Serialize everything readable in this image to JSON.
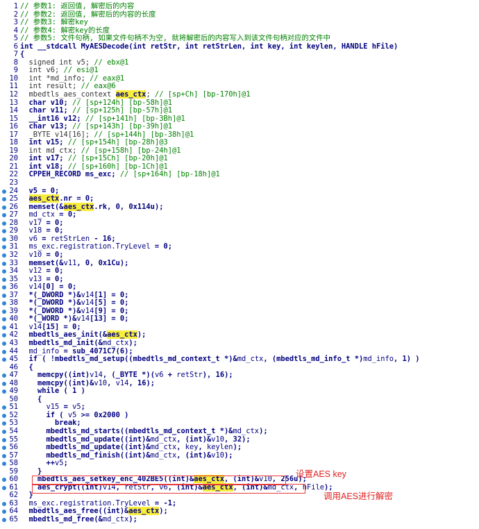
{
  "colors": {
    "background": "#ffffff",
    "code": "#000080",
    "comment": "#008000",
    "highlight": "#f8ed3a",
    "breakpoint_dot": "#2f86d6",
    "annotation": "#e02020"
  },
  "lines": [
    {
      "n": "1",
      "dot": false,
      "t": [
        {
          "c": "cm",
          "v": "// 参数1: 返回值, 解密后的内容"
        }
      ]
    },
    {
      "n": "2",
      "dot": false,
      "t": [
        {
          "c": "cm",
          "v": "// 参数2: 返回值, 解密后的内容的长度"
        }
      ]
    },
    {
      "n": "3",
      "dot": false,
      "t": [
        {
          "c": "cm",
          "v": "// 参数3: 解密key"
        }
      ]
    },
    {
      "n": "4",
      "dot": false,
      "t": [
        {
          "c": "cm",
          "v": "// 参数4: 解密key的长度"
        }
      ]
    },
    {
      "n": "5",
      "dot": false,
      "t": [
        {
          "c": "cm",
          "v": "// 参数5: 文件句柄, 如果文件句柄不为空, 就将解密后的内容写入到该文件句柄对应的文件中"
        }
      ]
    },
    {
      "n": "6",
      "dot": false,
      "t": [
        {
          "c": "",
          "v": "int __stdcall MyAESDecode(int retStr, int retStrLen, int key, int keylen, HANDLE hFile)"
        }
      ]
    },
    {
      "n": "7",
      "dot": false,
      "t": [
        {
          "c": "",
          "v": "{"
        }
      ]
    },
    {
      "n": "8",
      "dot": false,
      "t": [
        {
          "c": "dim",
          "v": "  signed int v5; "
        },
        {
          "c": "cm",
          "v": "// ebx@1"
        }
      ]
    },
    {
      "n": "9",
      "dot": false,
      "t": [
        {
          "c": "dim",
          "v": "  int v6; "
        },
        {
          "c": "cm",
          "v": "// esi@1"
        }
      ]
    },
    {
      "n": "10",
      "dot": false,
      "t": [
        {
          "c": "dim",
          "v": "  int *md_info; "
        },
        {
          "c": "cm",
          "v": "// eax@1"
        }
      ]
    },
    {
      "n": "11",
      "dot": false,
      "t": [
        {
          "c": "dim",
          "v": "  int result; "
        },
        {
          "c": "cm",
          "v": "// eax@6"
        }
      ]
    },
    {
      "n": "12",
      "dot": false,
      "t": [
        {
          "c": "dim",
          "v": "  mbedtls_aes_context "
        },
        {
          "c": "hl",
          "v": "aes_ctx"
        },
        {
          "c": "dim",
          "v": "; "
        },
        {
          "c": "cm",
          "v": "// [sp+Ch] [bp-170h]@1"
        }
      ]
    },
    {
      "n": "13",
      "dot": false,
      "t": [
        {
          "c": "",
          "v": "  char v10; "
        },
        {
          "c": "cm",
          "v": "// [sp+124h] [bp-58h]@1"
        }
      ]
    },
    {
      "n": "14",
      "dot": false,
      "t": [
        {
          "c": "",
          "v": "  char v11; "
        },
        {
          "c": "cm",
          "v": "// [sp+125h] [bp-57h]@1"
        }
      ]
    },
    {
      "n": "15",
      "dot": false,
      "t": [
        {
          "c": "",
          "v": "  __int16 v12; "
        },
        {
          "c": "cm",
          "v": "// [sp+141h] [bp-3Bh]@1"
        }
      ]
    },
    {
      "n": "16",
      "dot": false,
      "t": [
        {
          "c": "",
          "v": "  char v13; "
        },
        {
          "c": "cm",
          "v": "// [sp+143h] [bp-39h]@1"
        }
      ]
    },
    {
      "n": "17",
      "dot": false,
      "t": [
        {
          "c": "dim",
          "v": "  _BYTE v14[16]; "
        },
        {
          "c": "cm",
          "v": "// [sp+144h] [bp-38h]@1"
        }
      ]
    },
    {
      "n": "18",
      "dot": false,
      "t": [
        {
          "c": "",
          "v": "  int v15; "
        },
        {
          "c": "cm",
          "v": "// [sp+154h] [bp-28h]@3"
        }
      ]
    },
    {
      "n": "19",
      "dot": false,
      "t": [
        {
          "c": "dim",
          "v": "  int md_ctx; "
        },
        {
          "c": "cm",
          "v": "// [sp+158h] [bp-24h]@1"
        }
      ]
    },
    {
      "n": "20",
      "dot": false,
      "t": [
        {
          "c": "",
          "v": "  int v17; "
        },
        {
          "c": "cm",
          "v": "// [sp+15Ch] [bp-20h]@1"
        }
      ]
    },
    {
      "n": "21",
      "dot": false,
      "t": [
        {
          "c": "",
          "v": "  int v18; "
        },
        {
          "c": "cm",
          "v": "// [sp+160h] [bp-1Ch]@1"
        }
      ]
    },
    {
      "n": "22",
      "dot": false,
      "t": [
        {
          "c": "",
          "v": "  CPPEH_RECORD ms_exc; "
        },
        {
          "c": "cm",
          "v": "// [sp+164h] [bp-18h]@1"
        }
      ]
    },
    {
      "n": "23",
      "dot": false,
      "t": [
        {
          "c": "",
          "v": ""
        }
      ]
    },
    {
      "n": "24",
      "dot": true,
      "t": [
        {
          "c": "",
          "v": "  v5 = 0;"
        }
      ]
    },
    {
      "n": "25",
      "dot": true,
      "t": [
        {
          "c": "",
          "v": "  "
        },
        {
          "c": "hl",
          "v": "aes_ctx"
        },
        {
          "c": "",
          "v": ".nr = 0;"
        }
      ]
    },
    {
      "n": "26",
      "dot": true,
      "t": [
        {
          "c": "",
          "v": "  memset(&"
        },
        {
          "c": "hl",
          "v": "aes_ctx"
        },
        {
          "c": "",
          "v": ".rk, 0, 0x114u);"
        }
      ]
    },
    {
      "n": "27",
      "dot": true,
      "t": [
        {
          "c": "var",
          "v": "  md_ctx"
        },
        {
          "c": "",
          "v": " = 0;"
        }
      ]
    },
    {
      "n": "28",
      "dot": true,
      "t": [
        {
          "c": "var",
          "v": "  v17"
        },
        {
          "c": "",
          "v": " = 0;"
        }
      ]
    },
    {
      "n": "29",
      "dot": true,
      "t": [
        {
          "c": "var",
          "v": "  v18"
        },
        {
          "c": "",
          "v": " = 0;"
        }
      ]
    },
    {
      "n": "30",
      "dot": true,
      "t": [
        {
          "c": "var",
          "v": "  v6"
        },
        {
          "c": "",
          "v": " = "
        },
        {
          "c": "var",
          "v": "retStrLen"
        },
        {
          "c": "",
          "v": " - 16;"
        }
      ]
    },
    {
      "n": "31",
      "dot": true,
      "t": [
        {
          "c": "var",
          "v": "  ms_exc.registration.TryLevel"
        },
        {
          "c": "",
          "v": " = 0;"
        }
      ]
    },
    {
      "n": "32",
      "dot": true,
      "t": [
        {
          "c": "var",
          "v": "  v10"
        },
        {
          "c": "",
          "v": " = 0;"
        }
      ]
    },
    {
      "n": "33",
      "dot": true,
      "t": [
        {
          "c": "",
          "v": "  memset(&"
        },
        {
          "c": "var",
          "v": "v11"
        },
        {
          "c": "",
          "v": ", 0, 0x1Cu);"
        }
      ]
    },
    {
      "n": "34",
      "dot": true,
      "t": [
        {
          "c": "var",
          "v": "  v12"
        },
        {
          "c": "",
          "v": " = 0;"
        }
      ]
    },
    {
      "n": "35",
      "dot": true,
      "t": [
        {
          "c": "var",
          "v": "  v13"
        },
        {
          "c": "",
          "v": " = 0;"
        }
      ]
    },
    {
      "n": "36",
      "dot": true,
      "t": [
        {
          "c": "var",
          "v": "  v14"
        },
        {
          "c": "",
          "v": "[0] = 0;"
        }
      ]
    },
    {
      "n": "37",
      "dot": true,
      "t": [
        {
          "c": "",
          "v": "  *(_DWORD *)&"
        },
        {
          "c": "var",
          "v": "v14"
        },
        {
          "c": "",
          "v": "[1] = 0;"
        }
      ]
    },
    {
      "n": "38",
      "dot": true,
      "t": [
        {
          "c": "",
          "v": "  *(_DWORD *)&"
        },
        {
          "c": "var",
          "v": "v14"
        },
        {
          "c": "",
          "v": "[5] = 0;"
        }
      ]
    },
    {
      "n": "39",
      "dot": true,
      "t": [
        {
          "c": "",
          "v": "  *(_DWORD *)&"
        },
        {
          "c": "var",
          "v": "v14"
        },
        {
          "c": "",
          "v": "[9] = 0;"
        }
      ]
    },
    {
      "n": "40",
      "dot": true,
      "t": [
        {
          "c": "",
          "v": "  *(_WORD *)&"
        },
        {
          "c": "var",
          "v": "v14"
        },
        {
          "c": "",
          "v": "[13] = 0;"
        }
      ]
    },
    {
      "n": "41",
      "dot": true,
      "t": [
        {
          "c": "var",
          "v": "  v14"
        },
        {
          "c": "",
          "v": "[15] = 0;"
        }
      ]
    },
    {
      "n": "42",
      "dot": true,
      "t": [
        {
          "c": "",
          "v": "  mbedtls_aes_init(&"
        },
        {
          "c": "hl",
          "v": "aes_ctx"
        },
        {
          "c": "",
          "v": ");"
        }
      ]
    },
    {
      "n": "43",
      "dot": true,
      "t": [
        {
          "c": "",
          "v": "  mbedtls_md_init(&"
        },
        {
          "c": "var",
          "v": "md_ctx"
        },
        {
          "c": "",
          "v": ");"
        }
      ]
    },
    {
      "n": "44",
      "dot": true,
      "t": [
        {
          "c": "var",
          "v": "  md_info"
        },
        {
          "c": "",
          "v": " = sub_4071C7(6);"
        }
      ]
    },
    {
      "n": "45",
      "dot": true,
      "t": [
        {
          "c": "",
          "v": "  if ( !mbedtls_md_setup((mbedtls_md_context_t *)&"
        },
        {
          "c": "var",
          "v": "md_ctx"
        },
        {
          "c": "",
          "v": ", (mbedtls_md_info_t *)"
        },
        {
          "c": "var",
          "v": "md_info"
        },
        {
          "c": "",
          "v": ", 1) )"
        }
      ]
    },
    {
      "n": "46",
      "dot": false,
      "t": [
        {
          "c": "",
          "v": "  {"
        }
      ]
    },
    {
      "n": "47",
      "dot": true,
      "t": [
        {
          "c": "",
          "v": "    memcpy((int)"
        },
        {
          "c": "var",
          "v": "v14"
        },
        {
          "c": "",
          "v": ", (_BYTE *)("
        },
        {
          "c": "var",
          "v": "v6"
        },
        {
          "c": "",
          "v": " + "
        },
        {
          "c": "var",
          "v": "retStr"
        },
        {
          "c": "",
          "v": "), 16);"
        }
      ]
    },
    {
      "n": "48",
      "dot": true,
      "t": [
        {
          "c": "",
          "v": "    memcpy((int)&"
        },
        {
          "c": "var",
          "v": "v10"
        },
        {
          "c": "",
          "v": ", "
        },
        {
          "c": "var",
          "v": "v14"
        },
        {
          "c": "",
          "v": ", 16);"
        }
      ]
    },
    {
      "n": "49",
      "dot": true,
      "t": [
        {
          "c": "",
          "v": "    while ( 1 )"
        }
      ]
    },
    {
      "n": "50",
      "dot": false,
      "t": [
        {
          "c": "",
          "v": "    {"
        }
      ]
    },
    {
      "n": "51",
      "dot": true,
      "t": [
        {
          "c": "var",
          "v": "      v15"
        },
        {
          "c": "",
          "v": " = "
        },
        {
          "c": "var",
          "v": "v5"
        },
        {
          "c": "",
          "v": ";"
        }
      ]
    },
    {
      "n": "52",
      "dot": true,
      "t": [
        {
          "c": "",
          "v": "      if ( "
        },
        {
          "c": "var",
          "v": "v5"
        },
        {
          "c": "",
          "v": " >= 0x2000 )"
        }
      ]
    },
    {
      "n": "53",
      "dot": true,
      "t": [
        {
          "c": "",
          "v": "        break;"
        }
      ]
    },
    {
      "n": "54",
      "dot": true,
      "t": [
        {
          "c": "",
          "v": "      mbedtls_md_starts((mbedtls_md_context_t *)&"
        },
        {
          "c": "var",
          "v": "md_ctx"
        },
        {
          "c": "",
          "v": ");"
        }
      ]
    },
    {
      "n": "55",
      "dot": true,
      "t": [
        {
          "c": "",
          "v": "      mbedtls_md_update((int)&"
        },
        {
          "c": "var",
          "v": "md_ctx"
        },
        {
          "c": "",
          "v": ", (int)&"
        },
        {
          "c": "var",
          "v": "v10"
        },
        {
          "c": "",
          "v": ", 32);"
        }
      ]
    },
    {
      "n": "56",
      "dot": true,
      "t": [
        {
          "c": "",
          "v": "      mbedtls_md_update((int)&"
        },
        {
          "c": "var",
          "v": "md_ctx"
        },
        {
          "c": "",
          "v": ", "
        },
        {
          "c": "var",
          "v": "key"
        },
        {
          "c": "",
          "v": ", "
        },
        {
          "c": "var",
          "v": "keylen"
        },
        {
          "c": "",
          "v": ");"
        }
      ]
    },
    {
      "n": "57",
      "dot": true,
      "t": [
        {
          "c": "",
          "v": "      mbedtls_md_finish((int)&"
        },
        {
          "c": "var",
          "v": "md_ctx"
        },
        {
          "c": "",
          "v": ", (int)&"
        },
        {
          "c": "var",
          "v": "v10"
        },
        {
          "c": "",
          "v": ");"
        }
      ]
    },
    {
      "n": "58",
      "dot": true,
      "t": [
        {
          "c": "",
          "v": "      ++"
        },
        {
          "c": "var",
          "v": "v5"
        },
        {
          "c": "",
          "v": ";"
        }
      ]
    },
    {
      "n": "59",
      "dot": false,
      "t": [
        {
          "c": "",
          "v": "    }"
        }
      ]
    },
    {
      "n": "60",
      "dot": true,
      "t": [
        {
          "c": "",
          "v": "    mbedtls_aes_setkey_enc_402BE5((int)&"
        },
        {
          "c": "hl",
          "v": "aes_ctx"
        },
        {
          "c": "",
          "v": ", (int)&"
        },
        {
          "c": "var",
          "v": "v10"
        },
        {
          "c": "",
          "v": ", 256u);"
        }
      ]
    },
    {
      "n": "61",
      "dot": true,
      "t": [
        {
          "c": "",
          "v": "    aes_crypt((int)"
        },
        {
          "c": "var",
          "v": "v14"
        },
        {
          "c": "",
          "v": ", "
        },
        {
          "c": "var",
          "v": "retStr"
        },
        {
          "c": "",
          "v": ", "
        },
        {
          "c": "var",
          "v": "v6"
        },
        {
          "c": "",
          "v": ", (int)&"
        },
        {
          "c": "hl",
          "v": "aes_ctx"
        },
        {
          "c": "",
          "v": ", (int)&"
        },
        {
          "c": "var",
          "v": "md_ctx"
        },
        {
          "c": "",
          "v": ", "
        },
        {
          "c": "var",
          "v": "hFile"
        },
        {
          "c": "",
          "v": ");"
        }
      ]
    },
    {
      "n": "62",
      "dot": false,
      "t": [
        {
          "c": "",
          "v": "  }"
        }
      ]
    },
    {
      "n": "63",
      "dot": true,
      "t": [
        {
          "c": "var",
          "v": "  ms_exc.registration.TryLevel"
        },
        {
          "c": "",
          "v": " = -1;"
        }
      ]
    },
    {
      "n": "64",
      "dot": true,
      "t": [
        {
          "c": "",
          "v": "  mbedtls_aes_free((int)&"
        },
        {
          "c": "hl",
          "v": "aes_ctx"
        },
        {
          "c": "",
          "v": ");"
        }
      ]
    },
    {
      "n": "65",
      "dot": true,
      "t": [
        {
          "c": "",
          "v": "  mbedtls_md_free(&"
        },
        {
          "c": "var",
          "v": "md_ctx"
        },
        {
          "c": "",
          "v": ");"
        }
      ]
    }
  ],
  "annotations": {
    "setkey_note": "设置AES key",
    "crypt_note": "调用AES进行解密"
  }
}
